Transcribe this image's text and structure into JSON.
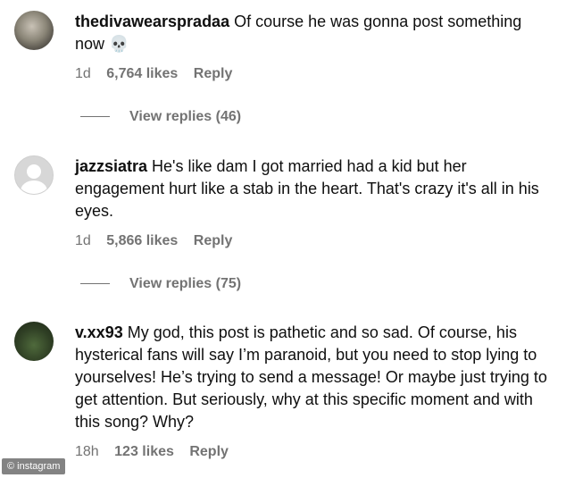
{
  "comments": [
    {
      "username": "thedivawearspradaa",
      "text": "Of course he was gonna post something now 💀",
      "time": "1d",
      "likes": "6,764 likes",
      "reply_label": "Reply",
      "view_replies": "View replies (46)"
    },
    {
      "username": "jazzsiatra",
      "text": "He's like dam I got married had a kid but her engagement hurt like a stab in the heart. That's crazy it's all in his eyes.",
      "time": "1d",
      "likes": "5,866 likes",
      "reply_label": "Reply",
      "view_replies": "View replies (75)"
    },
    {
      "username": "v.xx93",
      "text": "My god, this post is pathetic and so sad. Of course, his hysterical fans will say I’m paranoid, but you need to stop lying to yourselves! He’s trying to send a message! Or maybe just trying to get attention. But seriously, why at this specific moment and with this song? Why?",
      "time": "18h",
      "likes": "123 likes",
      "reply_label": "Reply"
    }
  ],
  "watermark": "© instagram"
}
